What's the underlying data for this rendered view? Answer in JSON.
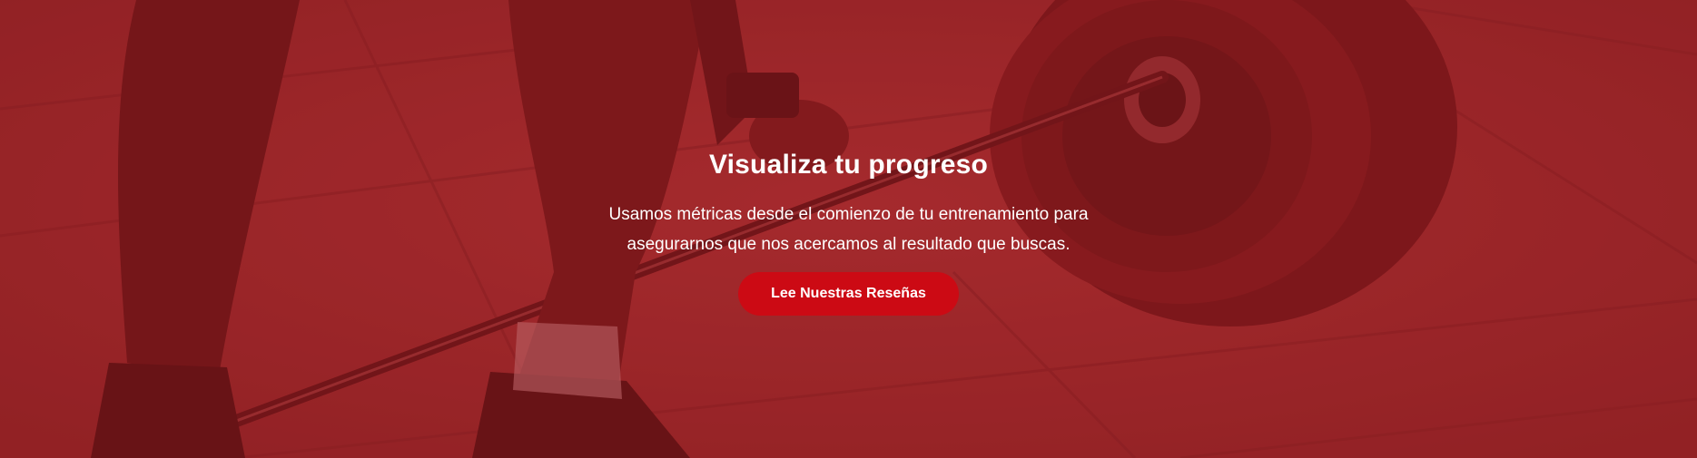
{
  "hero": {
    "title": "Visualiza tu progreso",
    "description_line1": "Usamos métricas desde el comienzo de tu entrenamiento para",
    "description_line2": "asegurarnos que nos acercamos al resultado que buscas.",
    "button_label": "Lee Nuestras Reseñas",
    "background_image": "weightlifting-deadlift-photo",
    "colors": {
      "overlay": "#9b2a2c",
      "button": "#cc0a14",
      "text": "#ffffff"
    }
  }
}
